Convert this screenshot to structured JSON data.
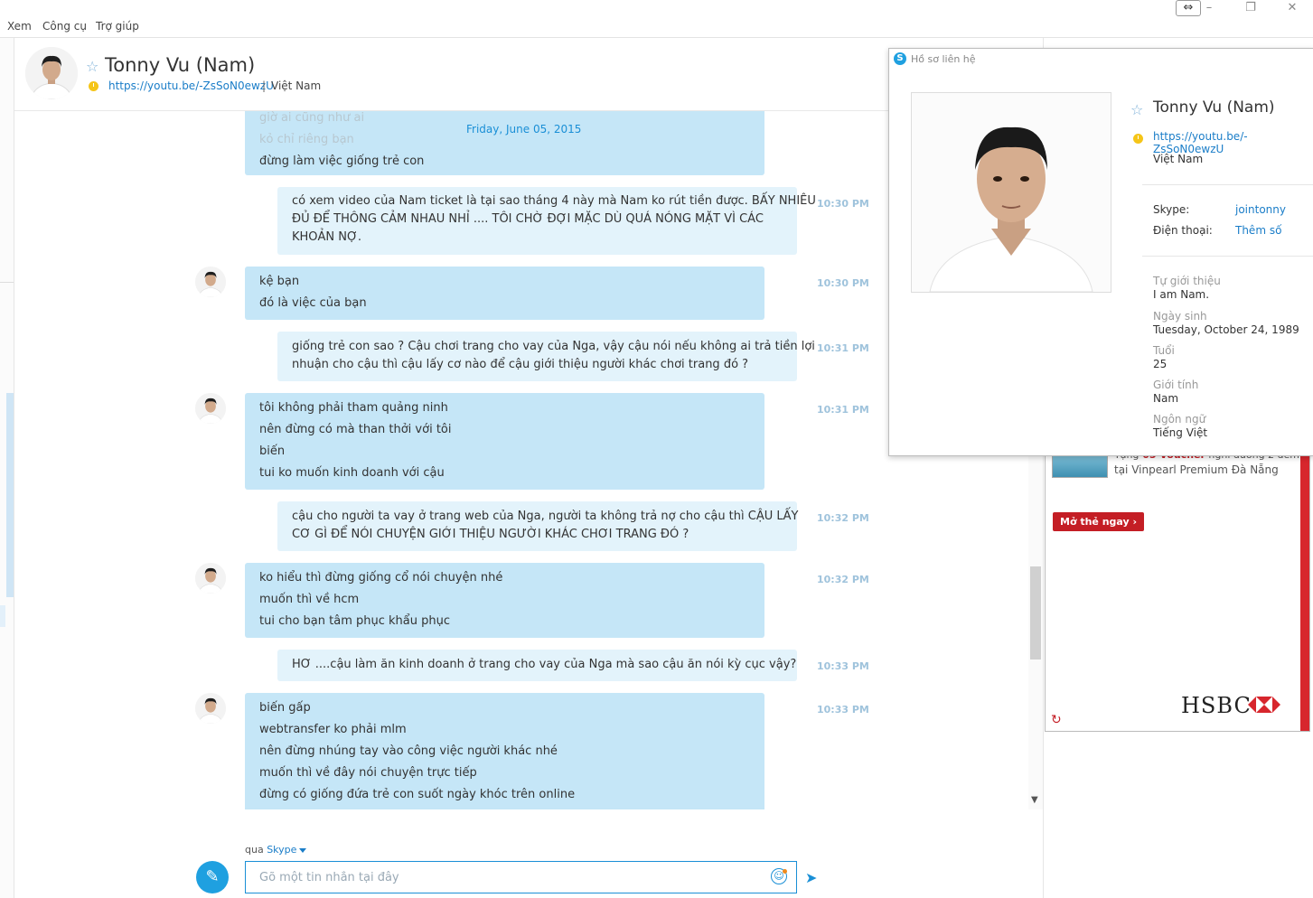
{
  "menu": {
    "items": [
      "Xem",
      "Công cụ",
      "Trợ giúp"
    ]
  },
  "header": {
    "name": "Tonny Vu (Nam)",
    "mood_link": "https://youtu.be/-ZsSoN0ewzU",
    "separator": "|",
    "country": "Việt Nam"
  },
  "conversation": {
    "date": "Friday, June 05, 2015",
    "faded_lines": [
      "giờ ai cũng như ai",
      "kỏ chỉ riêng bạn"
    ],
    "messages": [
      {
        "dir": "in",
        "avatar": false,
        "time": "",
        "lines": [
          "đừng làm việc giống trẻ con"
        ]
      },
      {
        "dir": "out",
        "time": "10:30 PM",
        "lines": [
          "có xem video của Nam ticket là tại sao tháng 4 này mà Nam ko rút tiền được. BẤY NHIÊU",
          "ĐỦ ĐỂ THÔNG CẢM NHAU NHỈ .... TÔI CHỜ ĐỢI MẶC DÙ QUÁ NÓNG MẶT VÌ CÁC",
          "KHOẢN NỢ."
        ]
      },
      {
        "dir": "in",
        "avatar": true,
        "time": "10:30 PM",
        "lines": [
          "kệ bạn",
          "đó là việc của bạn"
        ]
      },
      {
        "dir": "out",
        "time": "10:31 PM",
        "lines": [
          "giống trẻ con sao ? Cậu chơi trang cho vay của Nga, vậy cậu nói nếu không ai trả tiền lợi",
          "nhuận cho cậu thì cậu lấy cơ nào để cậu giới thiệu người khác chơi trang đó ?"
        ]
      },
      {
        "dir": "in",
        "avatar": true,
        "time": "10:31 PM",
        "lines": [
          "tôi không phải tham quảng ninh",
          "nên đừng có mà than thởi với tôi",
          "biến",
          "tui ko muốn kinh doanh với cậu"
        ]
      },
      {
        "dir": "out",
        "time": "10:32 PM",
        "lines": [
          "cậu cho người ta vay ở trang web của Nga, người ta không trả nợ cho cậu thì CẬU LẤY",
          "CƠ GÌ ĐỂ NÓI CHUYỆN GIỚI THIỆU NGƯỜI KHÁC CHƠI TRANG ĐÓ ?"
        ]
      },
      {
        "dir": "in",
        "avatar": true,
        "time": "10:32 PM",
        "lines": [
          "ko hiểu thì đừng giống cổ nói chuyện nhé",
          "muốn thì về hcm",
          "tui cho bạn tâm phục khẩu phục"
        ]
      },
      {
        "dir": "out",
        "time": "10:33 PM",
        "lines": [
          "HƠ ....cậu làm ăn kinh doanh ở trang cho vay của Nga mà sao cậu ăn nói kỳ cục vậy?"
        ]
      },
      {
        "dir": "in",
        "avatar": true,
        "time": "10:33 PM",
        "lines": [
          "biến gấp",
          "webtransfer ko phải mlm",
          "nên đừng nhúng tay vào công việc người khác nhé",
          "muốn thì về đây nói chuyện trực tiếp",
          "đừng có giống đứa trẻ con suốt ngày khóc trên online"
        ]
      }
    ]
  },
  "composer": {
    "via_label": "qua",
    "via_service": "Skype",
    "placeholder": "Gõ một tin nhắn tại đây"
  },
  "ad": {
    "line1_prefix": "Tặng",
    "line1_highlight": " 05 Voucher",
    "line1_suffix": " nghỉ dưỡng 2 đêm",
    "line2": "tại Vinpearl Premium Đà Nẵng",
    "cta": "Mở thẻ ngay",
    "brand": "HSBC"
  },
  "profile": {
    "title": "Hồ sơ liên hệ",
    "name": "Tonny Vu (Nam)",
    "mood_link": "https://youtu.be/-ZsSoN0ewzU",
    "country": "Việt Nam",
    "skype_label": "Skype:",
    "skype_value": "jointonny",
    "phone_label": "Điện thoại:",
    "phone_value": "Thêm số",
    "fields": [
      {
        "label": "Tự giới thiệu",
        "value": "I am Nam."
      },
      {
        "label": "Ngày sinh",
        "value": "Tuesday, October 24, 1989"
      },
      {
        "label": "Tuổi",
        "value": "25"
      },
      {
        "label": "Giới tính",
        "value": "Nam"
      },
      {
        "label": "Ngôn ngữ",
        "value": "Tiếng Việt"
      }
    ]
  },
  "colors": {
    "accent": "#1a8fd6",
    "bubble_in": "#c5e6f7",
    "bubble_out": "#e3f3fb",
    "ad_red": "#c41e25"
  }
}
